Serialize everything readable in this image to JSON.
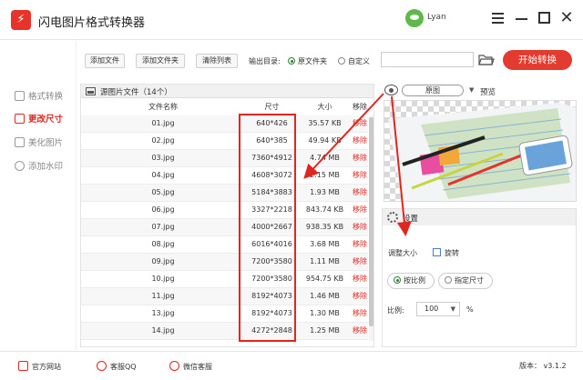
{
  "app": {
    "logo_glyph": "⚡",
    "title": "闪电图片格式转换器"
  },
  "user": {
    "name": "Lyan"
  },
  "window": {
    "close_glyph": "✕"
  },
  "sidebar": {
    "items": [
      {
        "label": "格式转换",
        "icon": "format-icon",
        "active": false
      },
      {
        "label": "更改尺寸",
        "icon": "resize-icon",
        "active": true
      },
      {
        "label": "美化图片",
        "icon": "beautify-icon",
        "active": false
      },
      {
        "label": "添加水印",
        "icon": "watermark-icon",
        "active": false
      }
    ]
  },
  "toolbar": {
    "add_file": "添加文件",
    "add_folder": "添加文件夹",
    "clear_list": "清除列表",
    "output_dir_label": "输出目录:",
    "original_folder": "原文件夹",
    "custom": "自定义",
    "path_value": "",
    "start_button": "开始转换"
  },
  "file_panel": {
    "title": "源图片文件（14个）",
    "columns": {
      "name": "文件名称",
      "size": "尺寸",
      "filesize": "大小",
      "remove": "移除"
    },
    "rows": [
      {
        "name": "01.jpg",
        "size": "640*426",
        "filesize": "35.57 KB",
        "remove": "移除"
      },
      {
        "name": "02.jpg",
        "size": "640*385",
        "filesize": "49.94 KB",
        "remove": "移除"
      },
      {
        "name": "03.jpg",
        "size": "7360*4912",
        "filesize": "4.74 MB",
        "remove": "移除"
      },
      {
        "name": "04.jpg",
        "size": "4608*3072",
        "filesize": "2.15 MB",
        "remove": "移除"
      },
      {
        "name": "05.jpg",
        "size": "5184*3883",
        "filesize": "1.93 MB",
        "remove": "移除"
      },
      {
        "name": "06.jpg",
        "size": "3327*2218",
        "filesize": "843.74 KB",
        "remove": "移除"
      },
      {
        "name": "07.jpg",
        "size": "4000*2667",
        "filesize": "938.35 KB",
        "remove": "移除"
      },
      {
        "name": "08.jpg",
        "size": "6016*4016",
        "filesize": "3.68 MB",
        "remove": "移除"
      },
      {
        "name": "09.jpg",
        "size": "7200*3580",
        "filesize": "1.11 MB",
        "remove": "移除"
      },
      {
        "name": "10.jpg",
        "size": "7200*3580",
        "filesize": "954.75 KB",
        "remove": "移除"
      },
      {
        "name": "11.jpg",
        "size": "8192*4073",
        "filesize": "1.46 MB",
        "remove": "移除"
      },
      {
        "name": "13.jpg",
        "size": "8192*4073",
        "filesize": "1.30 MB",
        "remove": "移除"
      },
      {
        "name": "14.jpg",
        "size": "4272*2848",
        "filesize": "1.25 MB",
        "remove": "移除"
      }
    ]
  },
  "preview": {
    "mode": "原图",
    "label": "预览"
  },
  "settings": {
    "title": "设置",
    "resize_label": "调整大小",
    "rotate_label": "旋转",
    "by_ratio": "按比例",
    "custom_size": "指定尺寸",
    "ratio_label": "比例:",
    "ratio_value": "100",
    "percent": "%"
  },
  "footer": {
    "website": "官方网站",
    "qq": "客服QQ",
    "wechat": "微信客服",
    "version": "版本： v3.1.2"
  },
  "colors": {
    "accent": "#e33b2f",
    "active_text": "#e0261f"
  }
}
